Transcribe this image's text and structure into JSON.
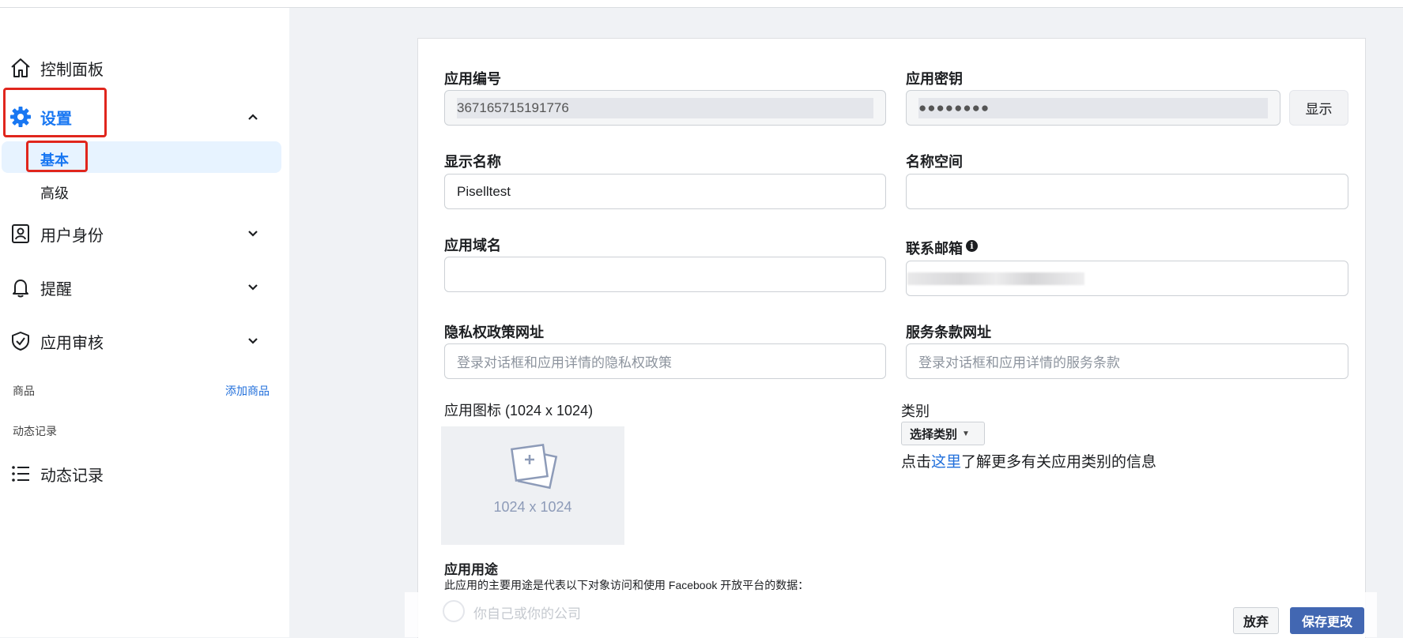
{
  "sidebar": {
    "dashboard": "控制面板",
    "settings": "设置",
    "settings_sub": [
      "基本",
      "高级"
    ],
    "user_identity": "用户身份",
    "alerts": "提醒",
    "app_review": "应用审核",
    "products_header": "商品",
    "add_product": "添加商品",
    "activity_header": "动态记录",
    "activity_log": "动态记录"
  },
  "form": {
    "app_id_label": "应用编号",
    "app_id_value": "367165715191776",
    "app_secret_label": "应用密钥",
    "app_secret_value": "●●●●●●●●",
    "show_button": "显示",
    "display_name_label": "显示名称",
    "display_name_value": "Piselltest",
    "namespace_label": "名称空间",
    "namespace_value": "",
    "app_domain_label": "应用域名",
    "app_domain_value": "",
    "contact_email_label": "联系邮箱",
    "privacy_url_label": "隐私权政策网址",
    "privacy_url_placeholder": "登录对话框和应用详情的隐私权政策",
    "terms_url_label": "服务条款网址",
    "terms_url_placeholder": "登录对话框和应用详情的服务条款",
    "app_icon_label": "应用图标 (1024 x 1024)",
    "app_icon_dims": "1024 x 1024",
    "category_label": "类别",
    "category_select": "选择类别",
    "category_info_prefix": "点击",
    "category_info_link": "这里",
    "category_info_suffix": "了解更多有关应用类别的信息",
    "app_purpose_label": "应用用途",
    "app_purpose_desc": "此应用的主要用途是代表以下对象访问和使用 Facebook 开放平台的数据：",
    "purpose_option": "你自己或你的公司"
  },
  "footer": {
    "discard": "放弃",
    "save": "保存更改"
  },
  "colors": {
    "accent": "#1877f2",
    "save_button": "#4267b2",
    "highlight_box": "#e0261d"
  }
}
